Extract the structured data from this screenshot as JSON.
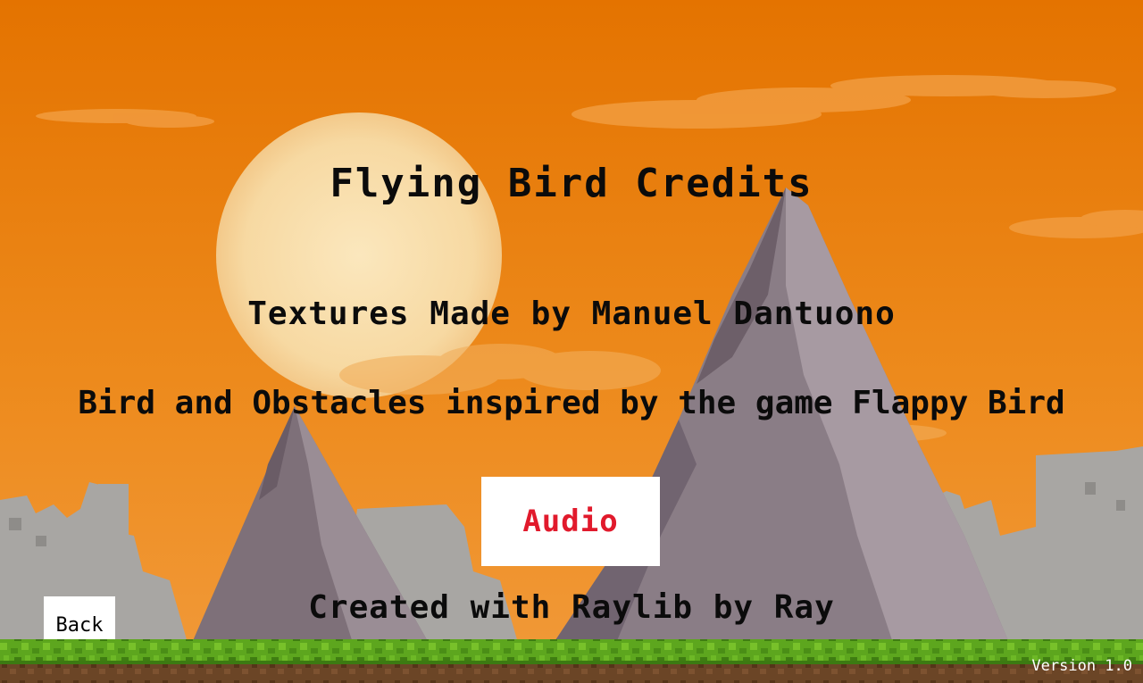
{
  "screen": {
    "title": "Flying Bird Credits",
    "credits": [
      "Textures Made by Manuel Dantuono",
      "Bird and Obstacles inspired by the game Flappy Bird",
      "Created with Raylib by Ray"
    ],
    "version": "Version 1.0"
  },
  "buttons": {
    "audio_label": "Audio",
    "back_label": "Back"
  },
  "colors": {
    "sky": "#e87a10",
    "sun": "#fbe2b0",
    "mountain": "#8a7b86",
    "ground_grass": "#5fa820",
    "ground_dirt": "#5a3a1e",
    "audio_text": "#e11a2c",
    "text": "#0b0b0b"
  },
  "icons": {
    "sun": "sun-icon",
    "bird": "none"
  }
}
